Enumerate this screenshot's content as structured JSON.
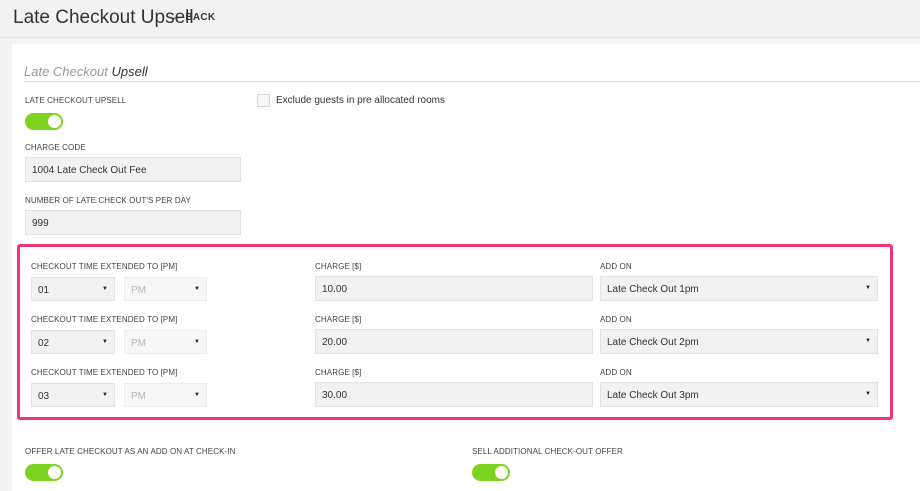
{
  "header": {
    "title": "Late Checkout Upsell",
    "back_label": "BACK",
    "back_icon": "arrow-left-icon"
  },
  "panel": {
    "title_prefix": "Late Checkout",
    "title_suffix": "Upsell"
  },
  "upsell_toggle": {
    "label": "LATE CHECKOUT UPSELL",
    "on": true
  },
  "exclude_checkbox": {
    "label": "Exclude guests in pre allocated rooms",
    "checked": false
  },
  "charge_code": {
    "label": "CHARGE CODE",
    "value": "1004 Late Check Out Fee"
  },
  "per_day": {
    "label": "NUMBER OF LATE CHECK OUT'S PER DAY",
    "value": "999"
  },
  "rows": [
    {
      "time_label": "CHECKOUT TIME EXTENDED TO [PM]",
      "hour": "01",
      "ampm": "PM",
      "charge_label": "CHARGE [$]",
      "charge": "10.00",
      "addon_label": "ADD ON",
      "addon": "Late Check Out 1pm"
    },
    {
      "time_label": "CHECKOUT TIME EXTENDED TO [PM]",
      "hour": "02",
      "ampm": "PM",
      "charge_label": "CHARGE [$]",
      "charge": "20.00",
      "addon_label": "ADD ON",
      "addon": "Late Check Out 2pm"
    },
    {
      "time_label": "CHECKOUT TIME EXTENDED TO [PM]",
      "hour": "03",
      "ampm": "PM",
      "charge_label": "CHARGE [$]",
      "charge": "30.00",
      "addon_label": "ADD ON",
      "addon": "Late Check Out 3pm"
    }
  ],
  "offer_addon_toggle": {
    "label": "OFFER LATE CHECKOUT AS AN ADD ON AT CHECK-IN",
    "on": true
  },
  "sell_offer_toggle": {
    "label": "SELL ADDITIONAL CHECK-OUT OFFER",
    "on": true
  },
  "colors": {
    "toggle_on": "#7ed321",
    "highlight": "#f0366f"
  }
}
